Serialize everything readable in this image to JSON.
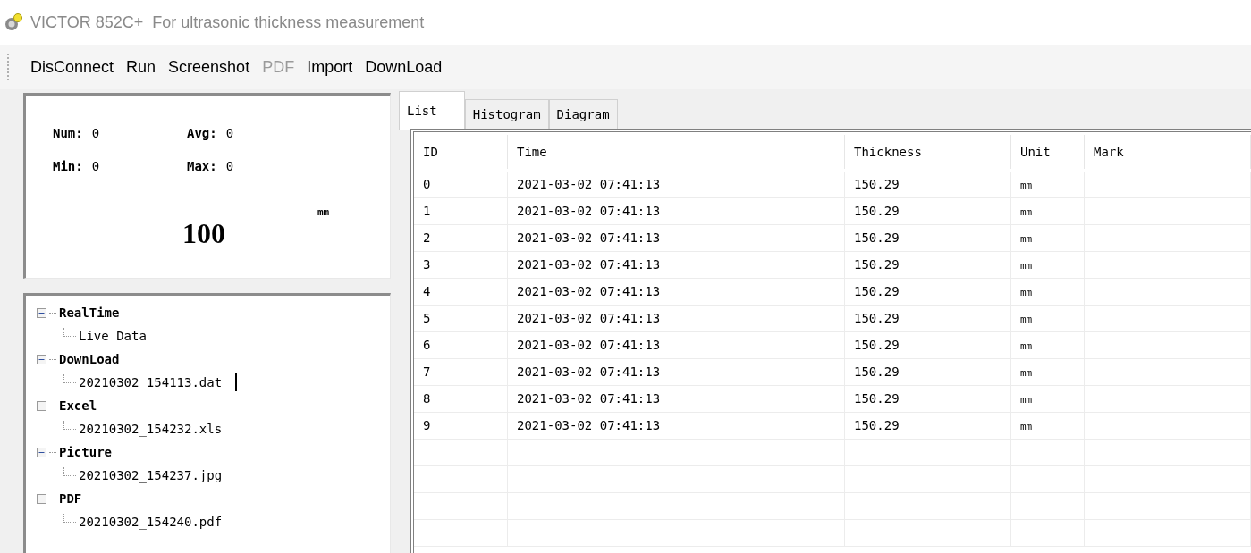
{
  "window": {
    "title": "VICTOR 852C+  For ultrasonic thickness measurement"
  },
  "toolbar": [
    {
      "label": "DisConnect",
      "disabled": false
    },
    {
      "label": "Run",
      "disabled": false
    },
    {
      "label": "Screenshot",
      "disabled": false
    },
    {
      "label": "PDF",
      "disabled": true
    },
    {
      "label": "Import",
      "disabled": false
    },
    {
      "label": "DownLoad",
      "disabled": false
    }
  ],
  "stats": [
    {
      "label": "Num:",
      "value": "0"
    },
    {
      "label": "Avg:",
      "value": "0"
    },
    {
      "label": "Min:",
      "value": "0"
    },
    {
      "label": "Max:",
      "value": "0"
    }
  ],
  "reading": {
    "value": "100",
    "unit": "mm"
  },
  "tree": [
    {
      "label": "RealTime",
      "expanded": true,
      "children": [
        {
          "label": "Live Data"
        }
      ]
    },
    {
      "label": "DownLoad",
      "expanded": true,
      "children": [
        {
          "label": "20210302_154113.dat",
          "editing": true
        }
      ]
    },
    {
      "label": "Excel",
      "expanded": true,
      "children": [
        {
          "label": "20210302_154232.xls"
        }
      ]
    },
    {
      "label": "Picture",
      "expanded": true,
      "children": [
        {
          "label": "20210302_154237.jpg"
        }
      ]
    },
    {
      "label": "PDF",
      "expanded": true,
      "children": [
        {
          "label": "20210302_154240.pdf"
        }
      ]
    }
  ],
  "tabs": [
    {
      "label": "List",
      "selected": true
    },
    {
      "label": "Histogram",
      "selected": false
    },
    {
      "label": "Diagram",
      "selected": false
    }
  ],
  "table": {
    "columns": [
      "ID",
      "Time",
      "Thickness",
      "Unit",
      "Mark"
    ],
    "rows": [
      [
        "0",
        "2021-03-02 07:41:13",
        "150.29",
        "mm"
      ],
      [
        "1",
        "2021-03-02 07:41:13",
        "150.29",
        "mm"
      ],
      [
        "2",
        "2021-03-02 07:41:13",
        "150.29",
        "mm"
      ],
      [
        "3",
        "2021-03-02 07:41:13",
        "150.29",
        "mm"
      ],
      [
        "4",
        "2021-03-02 07:41:13",
        "150.29",
        "mm"
      ],
      [
        "5",
        "2021-03-02 07:41:13",
        "150.29",
        "mm"
      ],
      [
        "6",
        "2021-03-02 07:41:13",
        "150.29",
        "mm"
      ],
      [
        "7",
        "2021-03-02 07:41:13",
        "150.29",
        "mm"
      ],
      [
        "8",
        "2021-03-02 07:41:13",
        "150.29",
        "mm"
      ],
      [
        "9",
        "2021-03-02 07:41:13",
        "150.29",
        "mm"
      ]
    ]
  }
}
